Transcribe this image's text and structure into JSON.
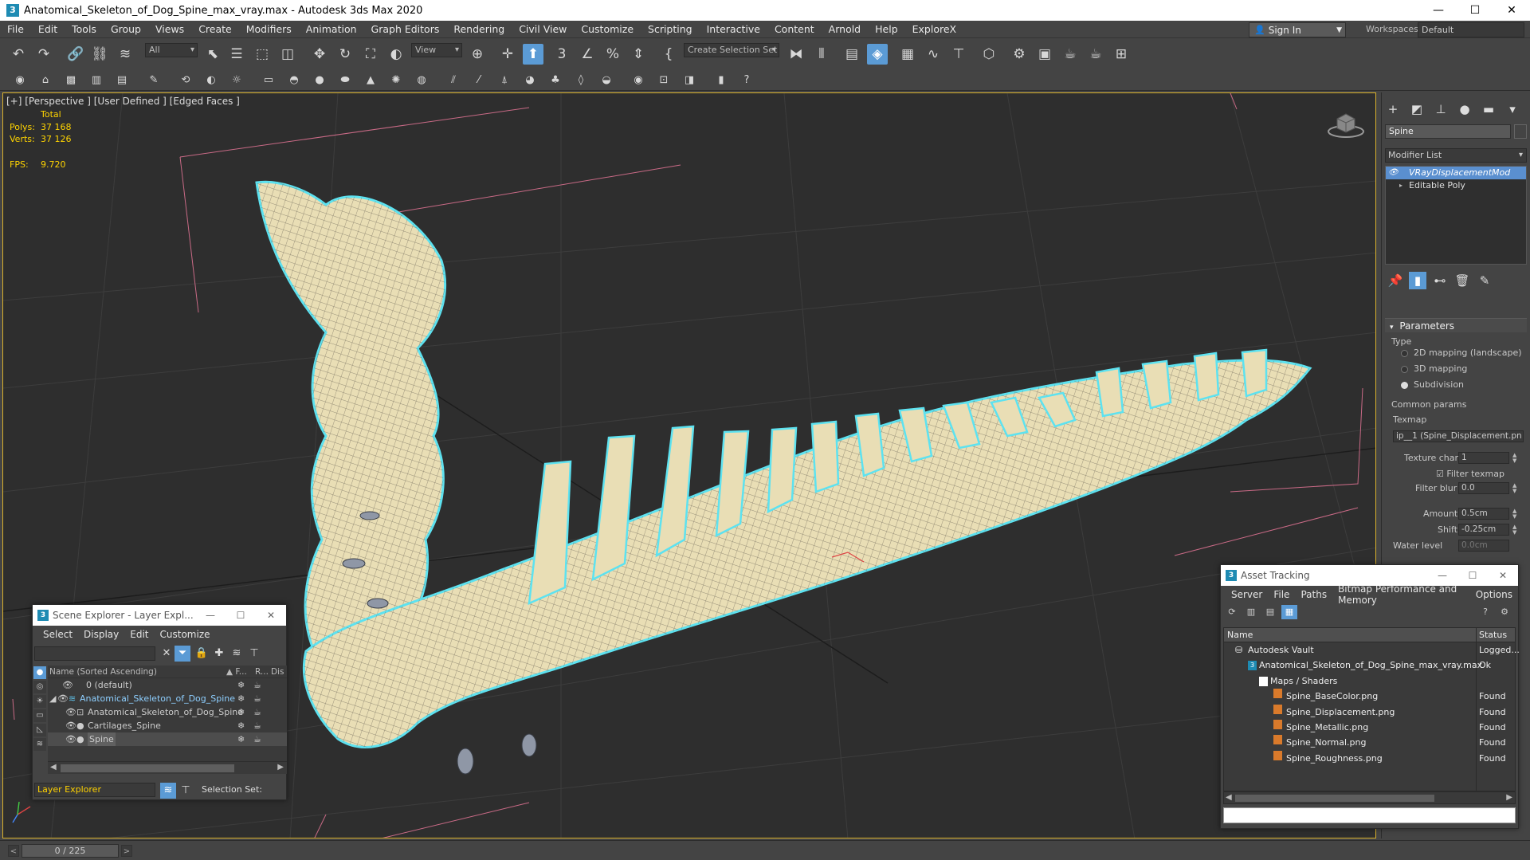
{
  "window": {
    "title": "Anatomical_Skeleton_of_Dog_Spine_max_vray.max - Autodesk 3ds Max 2020",
    "app_icon": "3",
    "minimize": "—",
    "maximize": "☐",
    "close": "✕"
  },
  "menu": [
    "File",
    "Edit",
    "Tools",
    "Group",
    "Views",
    "Create",
    "Modifiers",
    "Animation",
    "Graph Editors",
    "Rendering",
    "Civil View",
    "Customize",
    "Scripting",
    "Interactive",
    "Content",
    "Arnold",
    "Help",
    "ExploreX"
  ],
  "account": {
    "sign_in": "Sign In",
    "workspaces_label": "Workspaces:",
    "workspace": "Default"
  },
  "toolbar": {
    "filter_dropdown": "All",
    "view_dropdown": "View",
    "selection_set": "Create Selection Set"
  },
  "viewport": {
    "label": "[+] [Perspective ] [User Defined ] [Edged Faces ]",
    "stats_header": "Total",
    "polys_label": "Polys:",
    "polys_value": "37 168",
    "verts_label": "Verts:",
    "verts_value": "37 126",
    "fps_label": "FPS:",
    "fps_value": "9.720"
  },
  "command_panel": {
    "object_name": "Spine",
    "modifier_list": "Modifier List",
    "stack": [
      {
        "label": "VRayDisplacementMod",
        "selected": true
      },
      {
        "label": "Editable Poly",
        "selected": false
      }
    ],
    "parameters": {
      "title": "Parameters",
      "type_label": "Type",
      "types": [
        {
          "label": "2D mapping (landscape)",
          "on": false
        },
        {
          "label": "3D mapping",
          "on": false
        },
        {
          "label": "Subdivision",
          "on": true
        }
      ],
      "common_label": "Common params",
      "texmap_label": "Texmap",
      "texmap_value": "ip__1 (Spine_Displacement.pn",
      "texture_chan_label": "Texture chan",
      "texture_chan_value": "1",
      "filter_texmap": "Filter texmap",
      "filter_blur_label": "Filter blur",
      "filter_blur_value": "0.0",
      "amount_label": "Amount",
      "amount_value": "0.5cm",
      "shift_label": "Shift",
      "shift_value": "-0.25cm",
      "water_level_label": "Water level",
      "water_level_value": "0.0cm"
    }
  },
  "scene_explorer": {
    "title": "Scene Explorer - Layer Expl...",
    "menu": [
      "Select",
      "Display",
      "Edit",
      "Customize"
    ],
    "columns": {
      "name": "Name (Sorted Ascending)",
      "freeze": "▲ F...",
      "render": "R...",
      "display": "Dis"
    },
    "rows": [
      {
        "name": "0 (default)",
        "indent": 0,
        "highlight": false
      },
      {
        "name": "Anatomical_Skeleton_of_Dog_Spine",
        "indent": 0,
        "highlight": true
      },
      {
        "name": "Anatomical_Skeleton_of_Dog_Spine",
        "indent": 1,
        "highlight": false
      },
      {
        "name": "Cartilages_Spine",
        "indent": 1,
        "highlight": false
      },
      {
        "name": "Spine",
        "indent": 1,
        "highlight": false
      }
    ],
    "layer_explorer": "Layer Explorer",
    "selection_set": "Selection Set:"
  },
  "asset_tracking": {
    "title": "Asset Tracking",
    "menu": [
      "Server",
      "File",
      "Paths",
      "Bitmap Performance and Memory",
      "Options"
    ],
    "col_name": "Name",
    "col_status": "Status",
    "rows": [
      {
        "name": "Autodesk Vault",
        "status": "Logged...",
        "indent": 0,
        "icon": "vault"
      },
      {
        "name": "Anatomical_Skeleton_of_Dog_Spine_max_vray.max",
        "status": "Ok",
        "indent": 1,
        "icon": "max"
      },
      {
        "name": "Maps / Shaders",
        "status": "",
        "indent": 2,
        "icon": "folder"
      },
      {
        "name": "Spine_BaseColor.png",
        "status": "Found",
        "indent": 3,
        "icon": "png"
      },
      {
        "name": "Spine_Displacement.png",
        "status": "Found",
        "indent": 3,
        "icon": "png"
      },
      {
        "name": "Spine_Metallic.png",
        "status": "Found",
        "indent": 3,
        "icon": "png"
      },
      {
        "name": "Spine_Normal.png",
        "status": "Found",
        "indent": 3,
        "icon": "png"
      },
      {
        "name": "Spine_Roughness.png",
        "status": "Found",
        "indent": 3,
        "icon": "png"
      }
    ]
  },
  "timeline": {
    "frame": "0 / 225"
  },
  "colors": {
    "accent": "#5b9bd5",
    "viewport_border": "#d9b12c",
    "stats": "#ffd400",
    "bone": "#eadfb6",
    "outline": "#5de2f0"
  }
}
